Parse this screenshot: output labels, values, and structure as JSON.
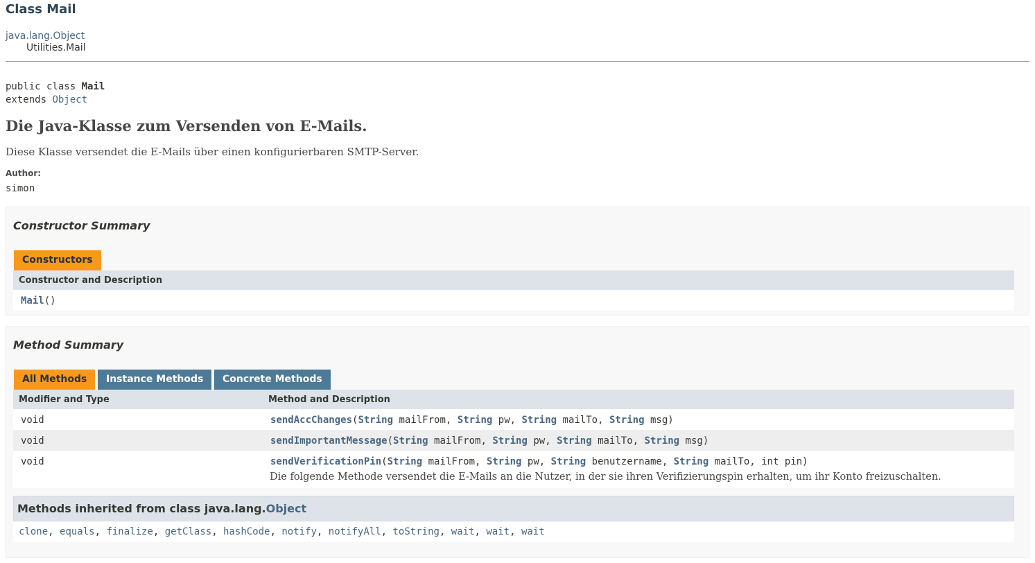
{
  "header": {
    "title": "Class Mail",
    "superclass_link": "java.lang.Object",
    "class_path": "Utilities.Mail"
  },
  "signature": {
    "line1_prefix": "public class ",
    "class_name": "Mail",
    "line2_prefix": "extends ",
    "extends_link": "Object"
  },
  "description": {
    "title": "Die Java-Klasse zum Versenden von E-Mails.",
    "text": "Diese Klasse versendet die E-Mails über einen konfigurierbaren SMTP-Server.",
    "author_label": "Author:",
    "author": "simon"
  },
  "constructor_summary": {
    "title": "Constructor Summary",
    "tab": "Constructors",
    "column": "Constructor and Description",
    "rows": [
      {
        "name": "Mail",
        "params": "()"
      }
    ]
  },
  "method_summary": {
    "title": "Method Summary",
    "tabs": [
      "All Methods",
      "Instance Methods",
      "Concrete Methods"
    ],
    "columns": [
      "Modifier and Type",
      "Method and Description"
    ],
    "rows": [
      {
        "type": "void",
        "name": "sendAccChanges",
        "params": [
          {
            "type": "String",
            "name": "mailFrom"
          },
          {
            "type": "String",
            "name": "pw"
          },
          {
            "type": "String",
            "name": "mailTo"
          },
          {
            "type": "String",
            "name": "msg"
          }
        ],
        "description": ""
      },
      {
        "type": "void",
        "name": "sendImportantMessage",
        "params": [
          {
            "type": "String",
            "name": "mailFrom"
          },
          {
            "type": "String",
            "name": "pw"
          },
          {
            "type": "String",
            "name": "mailTo"
          },
          {
            "type": "String",
            "name": "msg"
          }
        ],
        "description": ""
      },
      {
        "type": "void",
        "name": "sendVerificationPin",
        "params": [
          {
            "type": "String",
            "name": "mailFrom"
          },
          {
            "type": "String",
            "name": "pw"
          },
          {
            "type": "String",
            "name": "benutzername"
          },
          {
            "type": "String",
            "name": "mailTo"
          },
          {
            "type": "int",
            "name": "pin"
          }
        ],
        "description": "Die folgende Methode versendet die E-Mails an die Nutzer, in der sie ihren Verifizierungspin erhalten, um ihr Konto freizuschalten."
      }
    ]
  },
  "inherited": {
    "prefix": "Methods inherited from class java.lang.",
    "class_link": "Object",
    "methods": [
      "clone",
      "equals",
      "finalize",
      "getClass",
      "hashCode",
      "notify",
      "notifyAll",
      "toString",
      "wait",
      "wait",
      "wait"
    ]
  },
  "colors": {
    "link": "#4A6782",
    "tab_active": "#F8981D",
    "tab_inactive": "#4D7A97",
    "table_header": "#dee3e9",
    "block_bg": "#f8f8f8"
  }
}
